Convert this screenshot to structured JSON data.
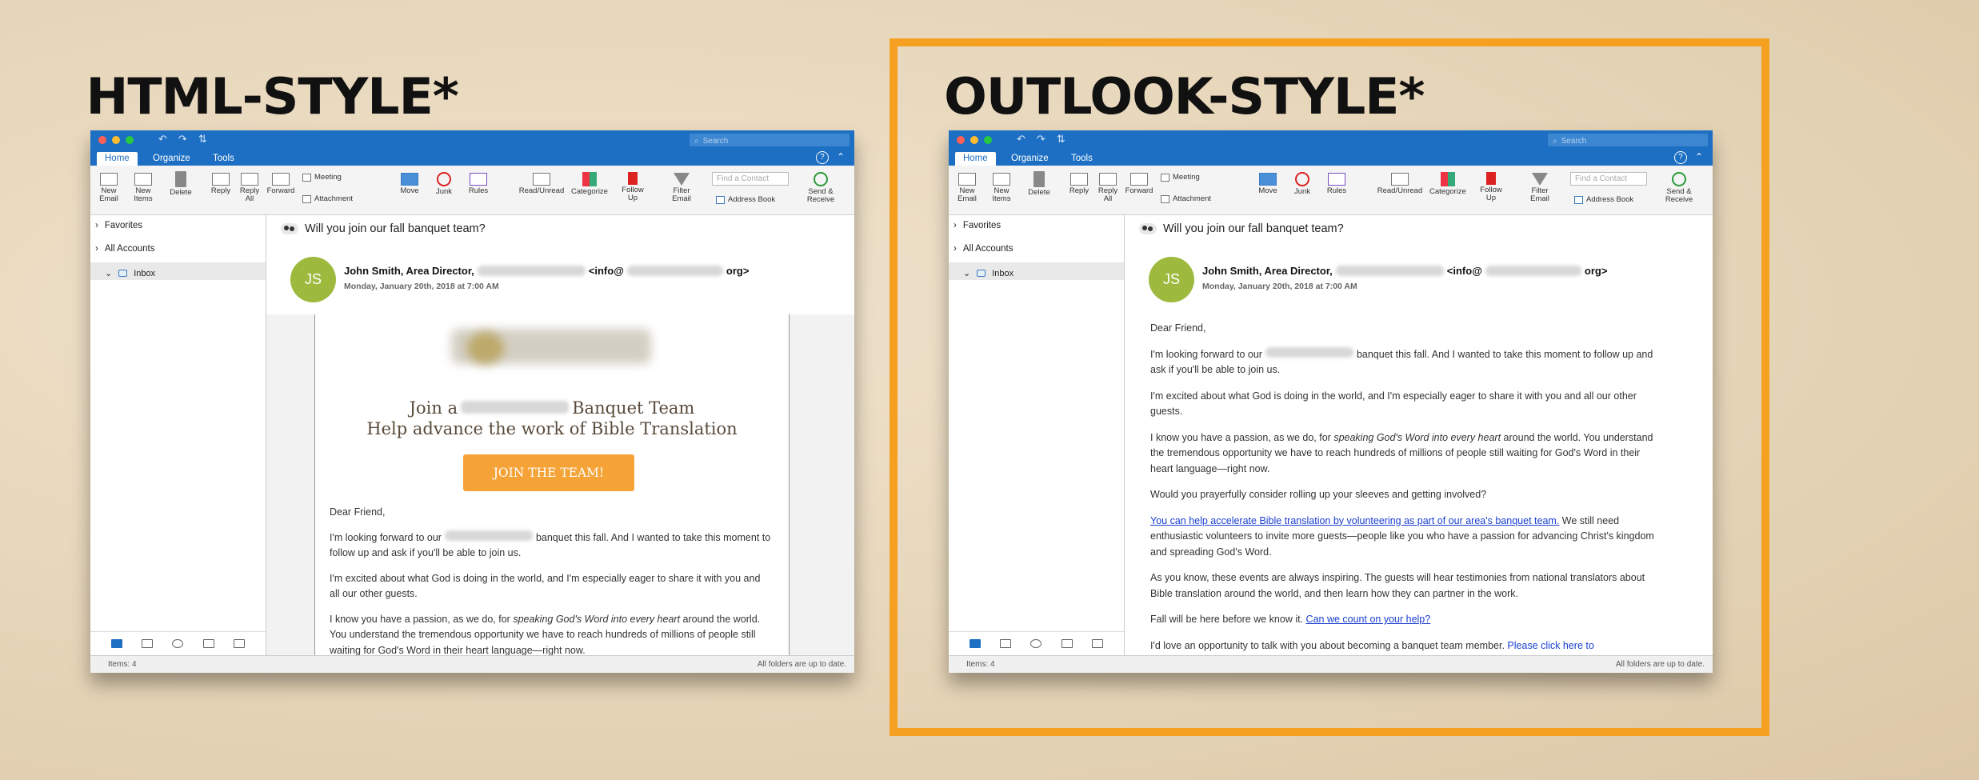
{
  "panels": {
    "left_title": "HTML-STYLE*",
    "right_title": "OUTLOOK-STYLE*"
  },
  "app": {
    "search_placeholder": "Search",
    "tabs": [
      "Home",
      "Organize",
      "Tools"
    ],
    "ribbon": {
      "new_email": "New\nEmail",
      "new_items": "New\nItems",
      "delete": "Delete",
      "reply": "Reply",
      "reply_all": "Reply\nAll",
      "forward": "Forward",
      "meeting": "Meeting",
      "attachment": "Attachment",
      "move": "Move",
      "junk": "Junk",
      "rules": "Rules",
      "read_unread": "Read/Unread",
      "categorize": "Categorize",
      "follow_up": "Follow\nUp",
      "filter_email": "Filter\nEmail",
      "find_contact": "Find a Contact",
      "address_book": "Address Book",
      "send_receive": "Send &\nReceive"
    },
    "sidebar": {
      "favorites": "Favorites",
      "all_accounts": "All Accounts",
      "inbox": "Inbox"
    },
    "status": {
      "items": "Items: 4",
      "sync": "All folders are up to date."
    },
    "accent_color": "#1c6fc2"
  },
  "email": {
    "subject": "Will you join our fall banquet team?",
    "avatar_initials": "JS",
    "from_name": "John Smith, Area Director,",
    "from_email_prefix": "<info@",
    "from_email_suffix": "org>",
    "date": "Monday, January 20th, 2018 at 7:00 AM"
  },
  "html_email": {
    "headline_prefix": "Join a",
    "headline_suffix": "Banquet Team",
    "headline_line2": "Help advance the work of Bible Translation",
    "button": "JOIN THE TEAM!",
    "greeting": "Dear Friend,",
    "p1_a": "I'm looking forward to our",
    "p1_b": "banquet this fall. And I wanted to take this moment to follow up and ask if you'll be able to join us.",
    "p2": "I'm excited about what God is doing in the world, and I'm especially eager to share it with you and all our other guests.",
    "p3_a": "I know you have a passion, as we do, for",
    "p3_em": "speaking God's Word into every heart",
    "p3_b": "around the world. You understand the tremendous opportunity we have to reach hundreds of millions of people still waiting for God's Word in their heart language—right now."
  },
  "outlook_email": {
    "greeting": "Dear Friend,",
    "p1_a": "I'm looking forward to our",
    "p1_b": "banquet this fall. And I wanted to take this moment to follow up and ask if you'll be able to join us.",
    "p2": "I'm excited about what God is doing in the world, and I'm especially eager to share it with you and all our other guests.",
    "p3_a": "I know you have a passion, as we do, for",
    "p3_em": "speaking God's Word into every heart",
    "p3_b": "around the world. You understand the tremendous opportunity we have to reach hundreds of millions of people still waiting for God's Word in their heart language—right now.",
    "p4": "Would you prayerfully consider rolling up your sleeves and getting involved?",
    "p5_link": "You can help accelerate Bible translation by volunteering as part of our area's banquet team.",
    "p5_b": "We still need enthusiastic volunteers to invite more guests—people like you who have a passion for advancing Christ's kingdom and spreading God's Word.",
    "p6": "As you know, these events are always inspiring. The guests will hear testimonies from national translators about Bible translation around the world, and then learn how they can partner in the work.",
    "p7_a": "Fall will be here before we know it.",
    "p7_link": "Can we count on your help?",
    "p8_a": "I'd love an opportunity to talk with you about becoming a banquet team member.",
    "p8_link": "Please click here to"
  }
}
